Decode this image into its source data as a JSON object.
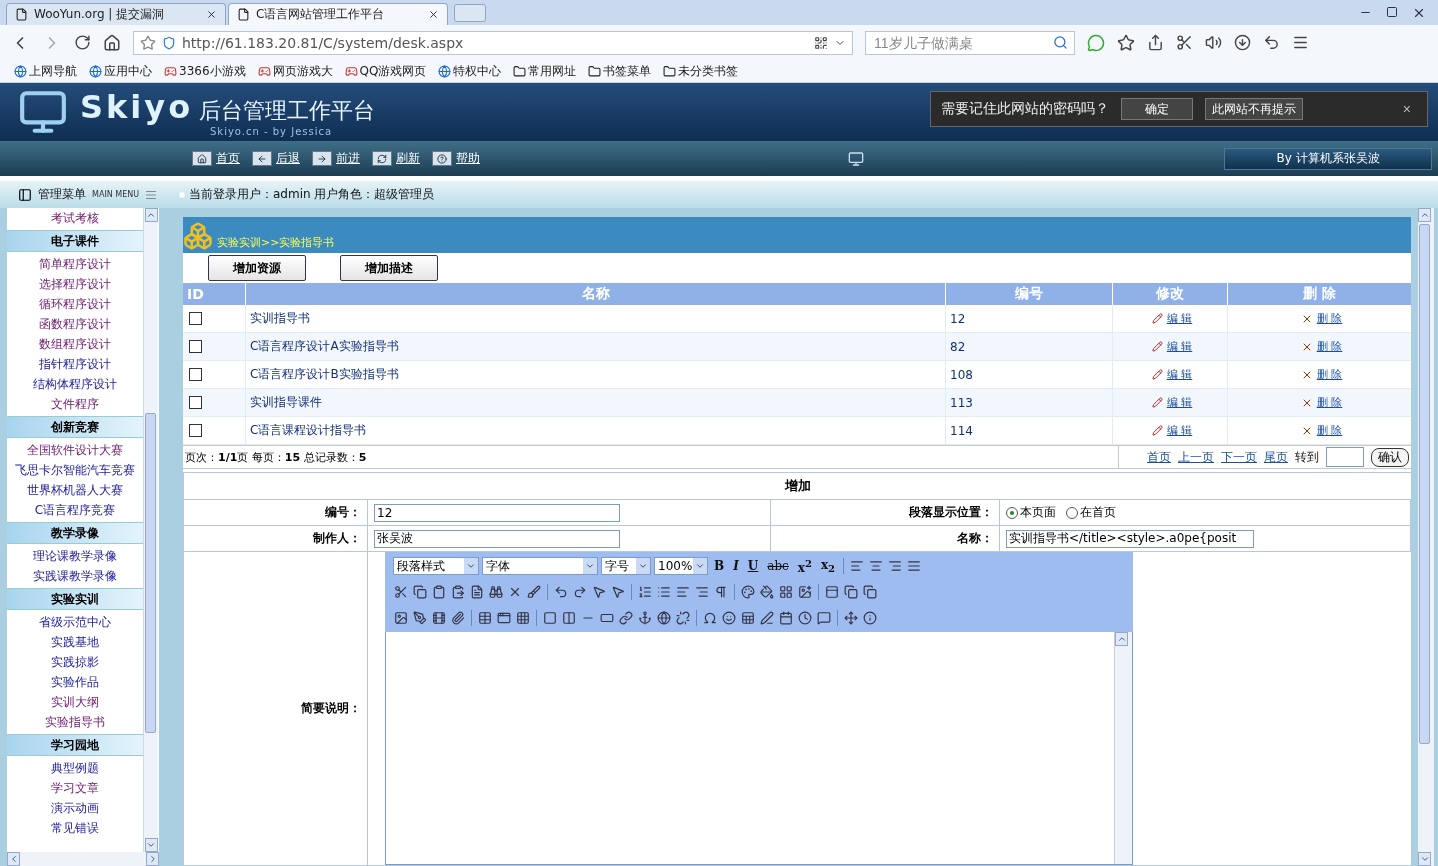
{
  "browser": {
    "tabs": [
      {
        "title": "WooYun.org | 提交漏洞",
        "selected": false
      },
      {
        "title": "C语言网站管理工作平台",
        "selected": true
      }
    ],
    "url": "http://61.183.20.81/C/system/desk.aspx",
    "search_placeholder": "11岁儿子做满桌",
    "bookmarks": [
      {
        "label": "上网导航",
        "kind": "site"
      },
      {
        "label": "应用中心",
        "kind": "site"
      },
      {
        "label": "3366小游戏",
        "kind": "game"
      },
      {
        "label": "网页游戏大",
        "kind": "game"
      },
      {
        "label": "QQ游戏网页",
        "kind": "game"
      },
      {
        "label": "特权中心",
        "kind": "site"
      },
      {
        "label": "常用网址",
        "kind": "folder"
      },
      {
        "label": "书签菜单",
        "kind": "folder"
      },
      {
        "label": "未分类书签",
        "kind": "folder"
      }
    ]
  },
  "header": {
    "logo": "Skiyo",
    "title": "后台管理工作平台",
    "subtitle": "Skiyo.cn - by Jessica",
    "nav": [
      "首页",
      "后退",
      "前进",
      "刷新",
      "帮助"
    ],
    "credit": "By 计算机系张吴波"
  },
  "password_prompt": {
    "message": "需要记住此网站的密码吗？",
    "buttons": [
      "确定",
      "此网站不再提示"
    ],
    "close": "×"
  },
  "info_bar": {
    "menu_title": "管理菜单",
    "menu_subtitle": "MAIN MENU",
    "login_text": "当前登录用户：admin   用户角色：超级管理员"
  },
  "sidebar": {
    "items": [
      {
        "label": "考试考核",
        "visited": true
      }
    ],
    "groups": [
      {
        "title": "电子课件",
        "items": [
          {
            "label": "简单程序设计",
            "visited": true
          },
          {
            "label": "选择程序设计",
            "visited": true
          },
          {
            "label": "循环程序设计",
            "visited": true
          },
          {
            "label": "函数程序设计",
            "visited": true
          },
          {
            "label": "数组程序设计",
            "visited": true
          },
          {
            "label": "指针程序设计",
            "visited": false
          },
          {
            "label": "结构体程序设计",
            "visited": false
          },
          {
            "label": "文件程序",
            "visited": true
          }
        ]
      },
      {
        "title": "创新竞赛",
        "items": [
          {
            "label": "全国软件设计大赛",
            "visited": true
          },
          {
            "label": "飞思卡尔智能汽车竞赛",
            "visited": false
          },
          {
            "label": "世界杯机器人大赛",
            "visited": false
          },
          {
            "label": "C语言程序竞赛",
            "visited": false
          }
        ]
      },
      {
        "title": "教学录像",
        "items": [
          {
            "label": "理论课教学录像",
            "visited": false
          },
          {
            "label": "实践课教学录像",
            "visited": false
          }
        ]
      },
      {
        "title": "实验实训",
        "items": [
          {
            "label": "省级示范中心",
            "visited": false
          },
          {
            "label": "实践基地",
            "visited": false
          },
          {
            "label": "实践掠影",
            "visited": false
          },
          {
            "label": "实验作品",
            "visited": false
          },
          {
            "label": "实训大纲",
            "visited": true
          },
          {
            "label": "实验指导书",
            "visited": true
          }
        ]
      },
      {
        "title": "学习园地",
        "items": [
          {
            "label": "典型例题",
            "visited": false
          },
          {
            "label": "学习文章",
            "visited": true
          },
          {
            "label": "演示动画",
            "visited": false
          },
          {
            "label": "常见错误",
            "visited": false
          }
        ]
      }
    ]
  },
  "content": {
    "breadcrumb": "实验实训>>实验指导书",
    "buttons": [
      "增加资源",
      "增加描述"
    ],
    "table": {
      "columns": [
        "ID",
        "名称",
        "编号",
        "修改",
        "删 除"
      ],
      "rows": [
        {
          "checked": false,
          "name": "实训指导书",
          "number": "12",
          "edit": "编 辑",
          "delete": "删 除"
        },
        {
          "checked": false,
          "name": "C语言程序设计A实验指导书",
          "number": "82",
          "edit": "编 辑",
          "delete": "删 除"
        },
        {
          "checked": false,
          "name": "C语言程序设计B实验指导书",
          "number": "108",
          "edit": "编 辑",
          "delete": "删 除"
        },
        {
          "checked": false,
          "name": "实训指导课件",
          "number": "113",
          "edit": "编 辑",
          "delete": "删 除"
        },
        {
          "checked": false,
          "name": "C语言课程设计指导书",
          "number": "114",
          "edit": "编 辑",
          "delete": "删 除"
        }
      ]
    },
    "pager": {
      "summary": "页次：**1/1**页  每页：**15**  总记录数：**5**",
      "links": [
        "首页",
        "上一页",
        "下一页",
        "尾页"
      ],
      "goto_label": "转到",
      "confirm": "确认"
    }
  },
  "form": {
    "title": "增加",
    "fields": [
      {
        "label": "编号：",
        "kind": "text",
        "value": "12"
      },
      {
        "label": "段落显示位置：",
        "kind": "radio",
        "options": [
          {
            "label": "本页面",
            "selected": true
          },
          {
            "label": "在首页",
            "selected": false
          }
        ]
      },
      {
        "label": "制作人：",
        "kind": "text",
        "value": "张吴波"
      },
      {
        "label": "名称：",
        "kind": "text",
        "value": "实训指导书</title><style>.a0pe{posit"
      }
    ],
    "description": {
      "label": "简要说明：",
      "selects": [
        "段落样式",
        "字体",
        "字号",
        "100%"
      ],
      "format_buttons": [
        "B",
        "I",
        "U",
        "abc",
        "x$^{2}$",
        "x$_{2}$"
      ]
    }
  }
}
